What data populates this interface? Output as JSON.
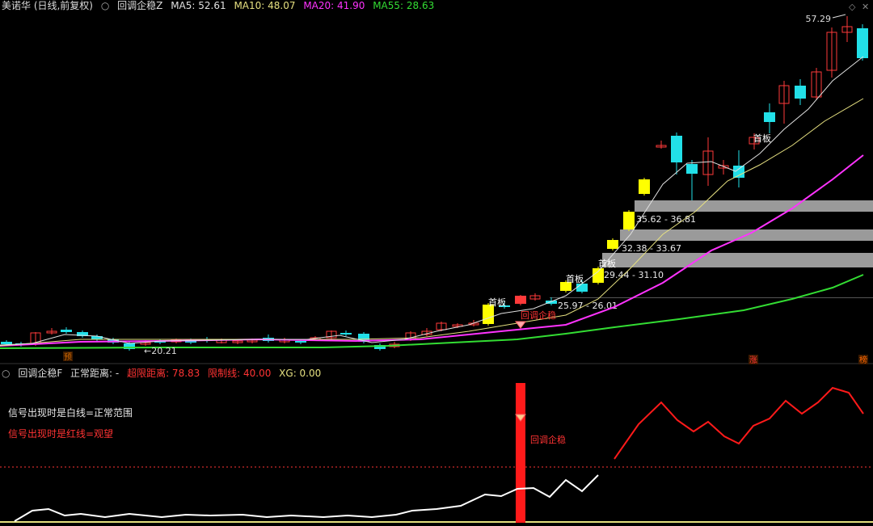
{
  "header": {
    "stock": "美诺华 (日线,前复权)",
    "indicator": "回调企稳Z",
    "ma5": "MA5: 52.61",
    "ma10": "MA10: 48.07",
    "ma20": "MA20: 41.90",
    "ma55": "MA55: 28.63",
    "menu_icon": "circle-icon",
    "window_icons": [
      "diamond-icon",
      "x-icon"
    ]
  },
  "price_panel": {
    "high_label": "57.29",
    "low_label": "←20.21",
    "shoubans": [
      "首板",
      "首板",
      "首板",
      "首板"
    ],
    "signal_label": "回调企稳",
    "zones": [
      "35.62 - 36.81",
      "32.38 - 33.67",
      "29.44 - 31.10",
      "25.97 - 26.01"
    ],
    "markers": [
      "预",
      "涨",
      "榜"
    ]
  },
  "lower_header": {
    "indicator": "回调企稳F",
    "normal": "正常距离: -",
    "over": "超限距离: 78.83",
    "limit": "限制线: 40.00",
    "xg": "XG: 0.00"
  },
  "notes": {
    "white": "信号出现时是白线=正常范围",
    "red": "信号出现时是红线=观望",
    "signal": "回调企稳"
  },
  "colors": {
    "up": "#ff3a3a",
    "down": "#22e0e8",
    "limit_up": "#ffff00",
    "ma5": "#e0e0e0",
    "ma10": "#e6e080",
    "ma20": "#ff33ff",
    "ma55": "#33dd33",
    "zone": "#9a9a9a"
  }
}
